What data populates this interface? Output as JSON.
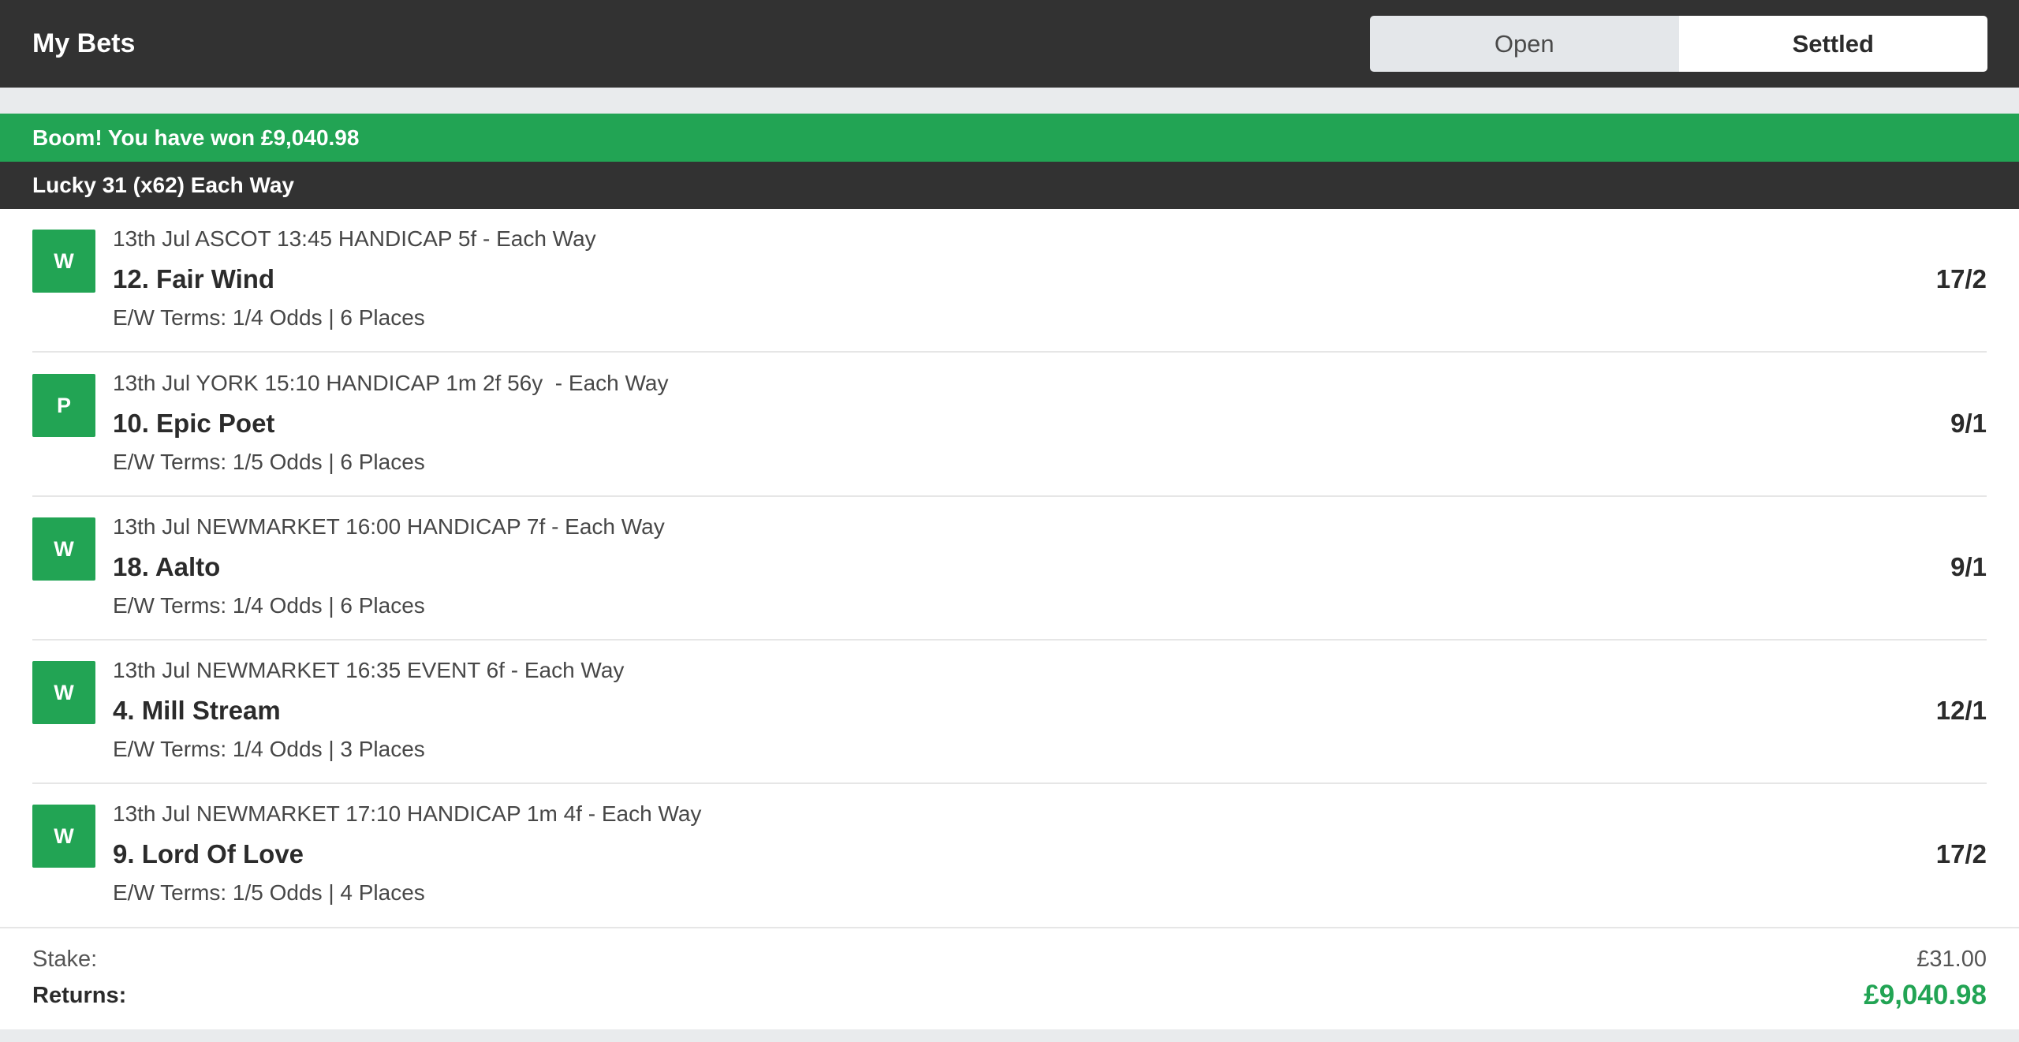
{
  "header": {
    "title": "My Bets",
    "tabs": [
      {
        "label": "Open",
        "active": false
      },
      {
        "label": "Settled",
        "active": true
      }
    ]
  },
  "bet": {
    "win_message": "Boom! You have won £9,040.98",
    "bet_type": "Lucky 31 (x62) Each Way",
    "selections": [
      {
        "result": "W",
        "race": "13th Jul ASCOT 13:45 HANDICAP 5f - Each Way",
        "runner": "12. Fair Wind",
        "terms": "E/W Terms: 1/4 Odds | 6 Places",
        "odds": "17/2"
      },
      {
        "result": "P",
        "race": "13th Jul YORK 15:10 HANDICAP 1m 2f 56y  - Each Way",
        "runner": "10. Epic Poet",
        "terms": "E/W Terms: 1/5 Odds | 6 Places",
        "odds": "9/1"
      },
      {
        "result": "W",
        "race": "13th Jul NEWMARKET 16:00 HANDICAP 7f - Each Way",
        "runner": "18. Aalto",
        "terms": "E/W Terms: 1/4 Odds | 6 Places",
        "odds": "9/1"
      },
      {
        "result": "W",
        "race": "13th Jul NEWMARKET 16:35 EVENT 6f - Each Way",
        "runner": "4. Mill Stream",
        "terms": "E/W Terms: 1/4 Odds | 3 Places",
        "odds": "12/1"
      },
      {
        "result": "W",
        "race": "13th Jul NEWMARKET 17:10 HANDICAP 1m 4f - Each Way",
        "runner": "9. Lord Of Love",
        "terms": "E/W Terms: 1/5 Odds | 4 Places",
        "odds": "17/2"
      }
    ],
    "stake_label": "Stake:",
    "stake_value": "£31.00",
    "returns_label": "Returns:",
    "returns_value": "£9,040.98"
  },
  "colors": {
    "header_bg": "#323232",
    "win_green": "#22a454",
    "page_bg": "#e9ebed"
  }
}
